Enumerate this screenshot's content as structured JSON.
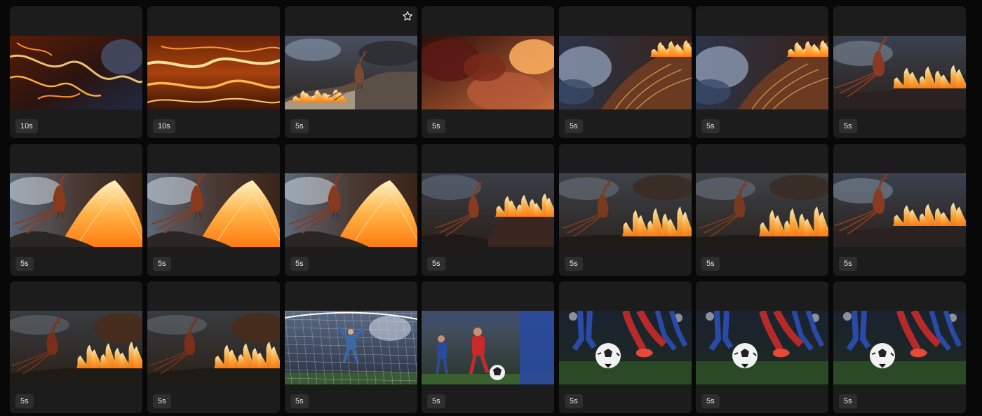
{
  "gallery": {
    "items": [
      {
        "duration": "10s",
        "scene": "fire-storm",
        "favorite": false
      },
      {
        "duration": "10s",
        "scene": "fire-lava",
        "favorite": false
      },
      {
        "duration": "5s",
        "scene": "phoenix-rock",
        "favorite": true
      },
      {
        "duration": "5s",
        "scene": "fire-clouds",
        "favorite": false
      },
      {
        "duration": "5s",
        "scene": "feathers-storm",
        "favorite": false
      },
      {
        "duration": "5s",
        "scene": "feathers-storm",
        "favorite": false
      },
      {
        "duration": "5s",
        "scene": "phoenix-fire-right",
        "favorite": false
      },
      {
        "duration": "5s",
        "scene": "phoenix-volcano",
        "favorite": false
      },
      {
        "duration": "5s",
        "scene": "phoenix-volcano",
        "favorite": false
      },
      {
        "duration": "5s",
        "scene": "phoenix-volcano",
        "favorite": false
      },
      {
        "duration": "5s",
        "scene": "phoenix-burning-hill",
        "favorite": false
      },
      {
        "duration": "5s",
        "scene": "phoenix-fire-wide",
        "favorite": false
      },
      {
        "duration": "5s",
        "scene": "phoenix-fire-wide",
        "favorite": false
      },
      {
        "duration": "5s",
        "scene": "phoenix-fire-right",
        "favorite": false
      },
      {
        "duration": "5s",
        "scene": "phoenix-dusk",
        "favorite": false
      },
      {
        "duration": "5s",
        "scene": "phoenix-dusk",
        "favorite": false
      },
      {
        "duration": "5s",
        "scene": "goalkeeper-net",
        "favorite": false
      },
      {
        "duration": "5s",
        "scene": "soccer-players",
        "favorite": false
      },
      {
        "duration": "5s",
        "scene": "soccer-ball-feet",
        "favorite": false
      },
      {
        "duration": "5s",
        "scene": "soccer-ball-feet",
        "favorite": false
      },
      {
        "duration": "5s",
        "scene": "soccer-ball-feet",
        "favorite": false
      }
    ]
  },
  "icons": {
    "favorite": "star-outline-icon"
  },
  "colors": {
    "background": "#080808",
    "card": "#1c1c1c",
    "badge": "#2e2e2e",
    "badge_text": "#e6e6e6"
  }
}
